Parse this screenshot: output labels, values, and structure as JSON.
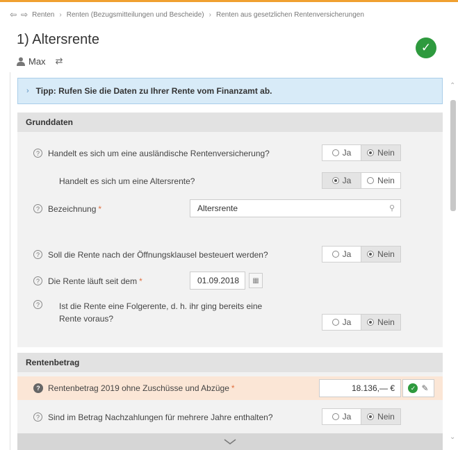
{
  "breadcrumb": {
    "items": [
      "Renten",
      "Renten (Bezugsmitteilungen und Bescheide)",
      "Renten aus gesetzlichen Rentenversicherungen"
    ]
  },
  "page": {
    "title": "1) Altersrente",
    "user": "Max"
  },
  "tip": {
    "text": "Tipp: Rufen Sie die Daten zu Ihrer Rente vom Finanzamt ab."
  },
  "grunddaten": {
    "header": "Grunddaten",
    "q1": {
      "label": "Handelt es sich um eine ausländische Rentenversicherung?",
      "yes": "Ja",
      "no": "Nein",
      "selected": "no"
    },
    "q2": {
      "label": "Handelt es sich um eine Altersrente?",
      "yes": "Ja",
      "no": "Nein",
      "selected": "yes"
    },
    "bezeichnung": {
      "label": "Bezeichnung",
      "value": "Altersrente"
    },
    "q3": {
      "label": "Soll die Rente nach der Öffnungsklausel besteuert werden?",
      "yes": "Ja",
      "no": "Nein",
      "selected": "no"
    },
    "seit": {
      "label": "Die Rente läuft seit dem",
      "value": "01.09.2018"
    },
    "q4": {
      "label_line1": "Ist die Rente eine Folgerente, d. h. ihr ging bereits eine",
      "label_line2": "Rente voraus?",
      "yes": "Ja",
      "no": "Nein",
      "selected": "no"
    }
  },
  "rentenbetrag": {
    "header": "Rentenbetrag",
    "betrag": {
      "label": "Rentenbetrag 2019 ohne Zuschüsse und Abzüge",
      "value": "18.136,— €"
    },
    "q5": {
      "label": "Sind im Betrag Nachzahlungen für mehrere Jahre enthalten?",
      "yes": "Ja",
      "no": "Nein",
      "selected": "no"
    }
  },
  "colors": {
    "accent": "#f0a030",
    "success": "#2e9a3e",
    "tip_bg": "#d8ebf8",
    "highlight_bg": "#fbe6d6"
  }
}
